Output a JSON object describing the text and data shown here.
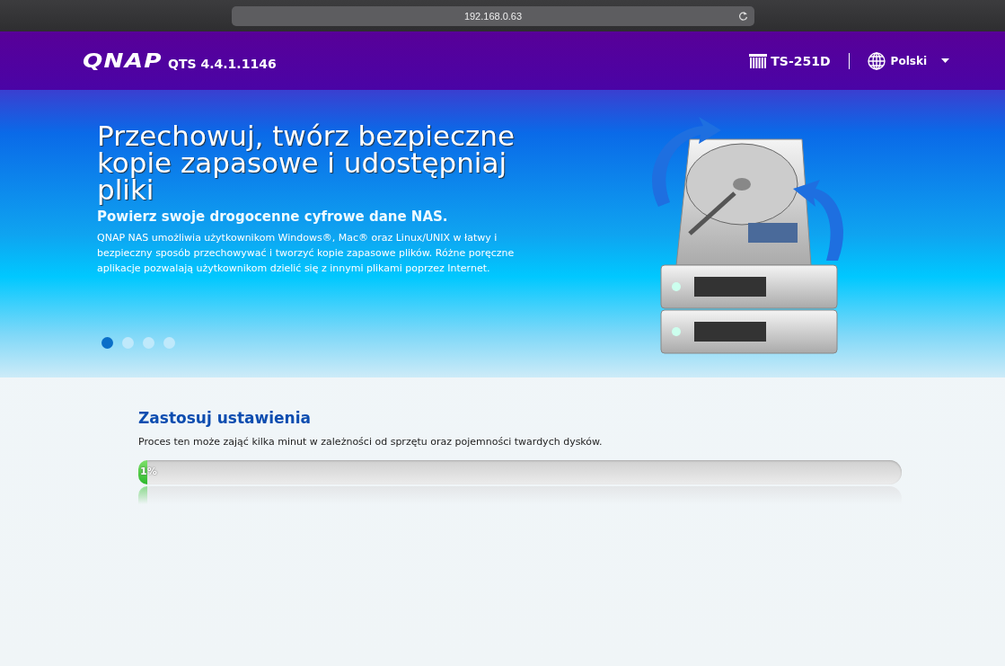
{
  "browser": {
    "address": "192.168.0.63"
  },
  "header": {
    "logo": "QNAP",
    "version": "QTS 4.4.1.1146",
    "device": "TS-251D",
    "language": "Polski"
  },
  "hero": {
    "title": "Przechowuj, twórz bezpieczne kopie zapasowe i udostępniaj pliki",
    "subtitle": "Powierz swoje drogocenne cyfrowe dane NAS.",
    "body": "QNAP NAS umożliwia użytkownikom Windows®, Mac® oraz Linux/UNIX w łatwy i bezpieczny sposób przechowywać i tworzyć kopie zapasowe plików. Różne poręczne aplikacje pozwalają użytkownikom dzielić się z innymi plikami poprzez Internet.",
    "slides": [
      {
        "selected": true
      },
      {
        "selected": false
      },
      {
        "selected": false
      },
      {
        "selected": false
      }
    ]
  },
  "setup": {
    "title": "Zastosuj ustawienia",
    "description": "Proces ten może zająć kilka minut w zależności od sprzętu oraz pojemności twardych dysków.",
    "progress": {
      "level": 0.01,
      "label": "1%"
    }
  }
}
